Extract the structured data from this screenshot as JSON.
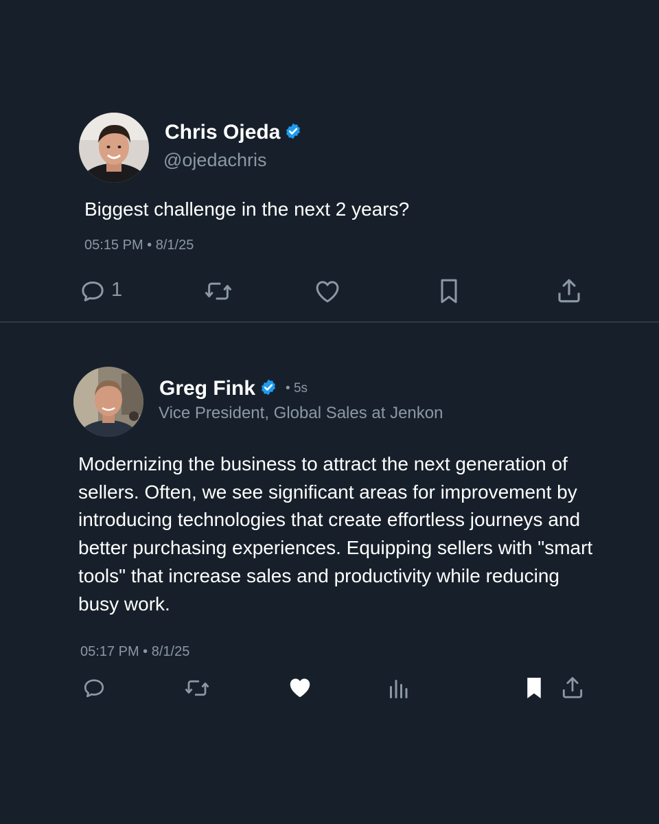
{
  "tweet1": {
    "author_name": "Chris Ojeda",
    "author_handle": "@ojedachris",
    "text": "Biggest challenge in the next 2 years?",
    "timestamp": "05:15 PM • 8/1/25",
    "reply_count": "1",
    "actions": [
      "reply-icon",
      "retweet-icon",
      "like-icon",
      "bookmark-icon",
      "share-icon"
    ]
  },
  "tweet2": {
    "author_name": "Greg Fink",
    "age": "• 5s",
    "author_title": "Vice President, Global Sales at Jenkon",
    "text": "Modernizing the business to attract the next generation of sellers. Often, we see significant areas for improvement by introducing technologies that create effortless journeys and better purchasing experiences. Equipping sellers with \"smart tools\" that increase sales and productivity while reducing busy work.",
    "timestamp": "05:17 PM • 8/1/25",
    "liked": true,
    "bookmarked": true,
    "actions": [
      "reply-icon",
      "retweet-icon",
      "like-icon-filled",
      "views-icon",
      "bookmark-icon-filled",
      "share-icon"
    ]
  },
  "colors": {
    "background": "#17202a",
    "text_primary": "#ffffff",
    "text_secondary": "#8b98a5",
    "verified_blue": "#1d9bf0",
    "divider": "#2f3943"
  }
}
